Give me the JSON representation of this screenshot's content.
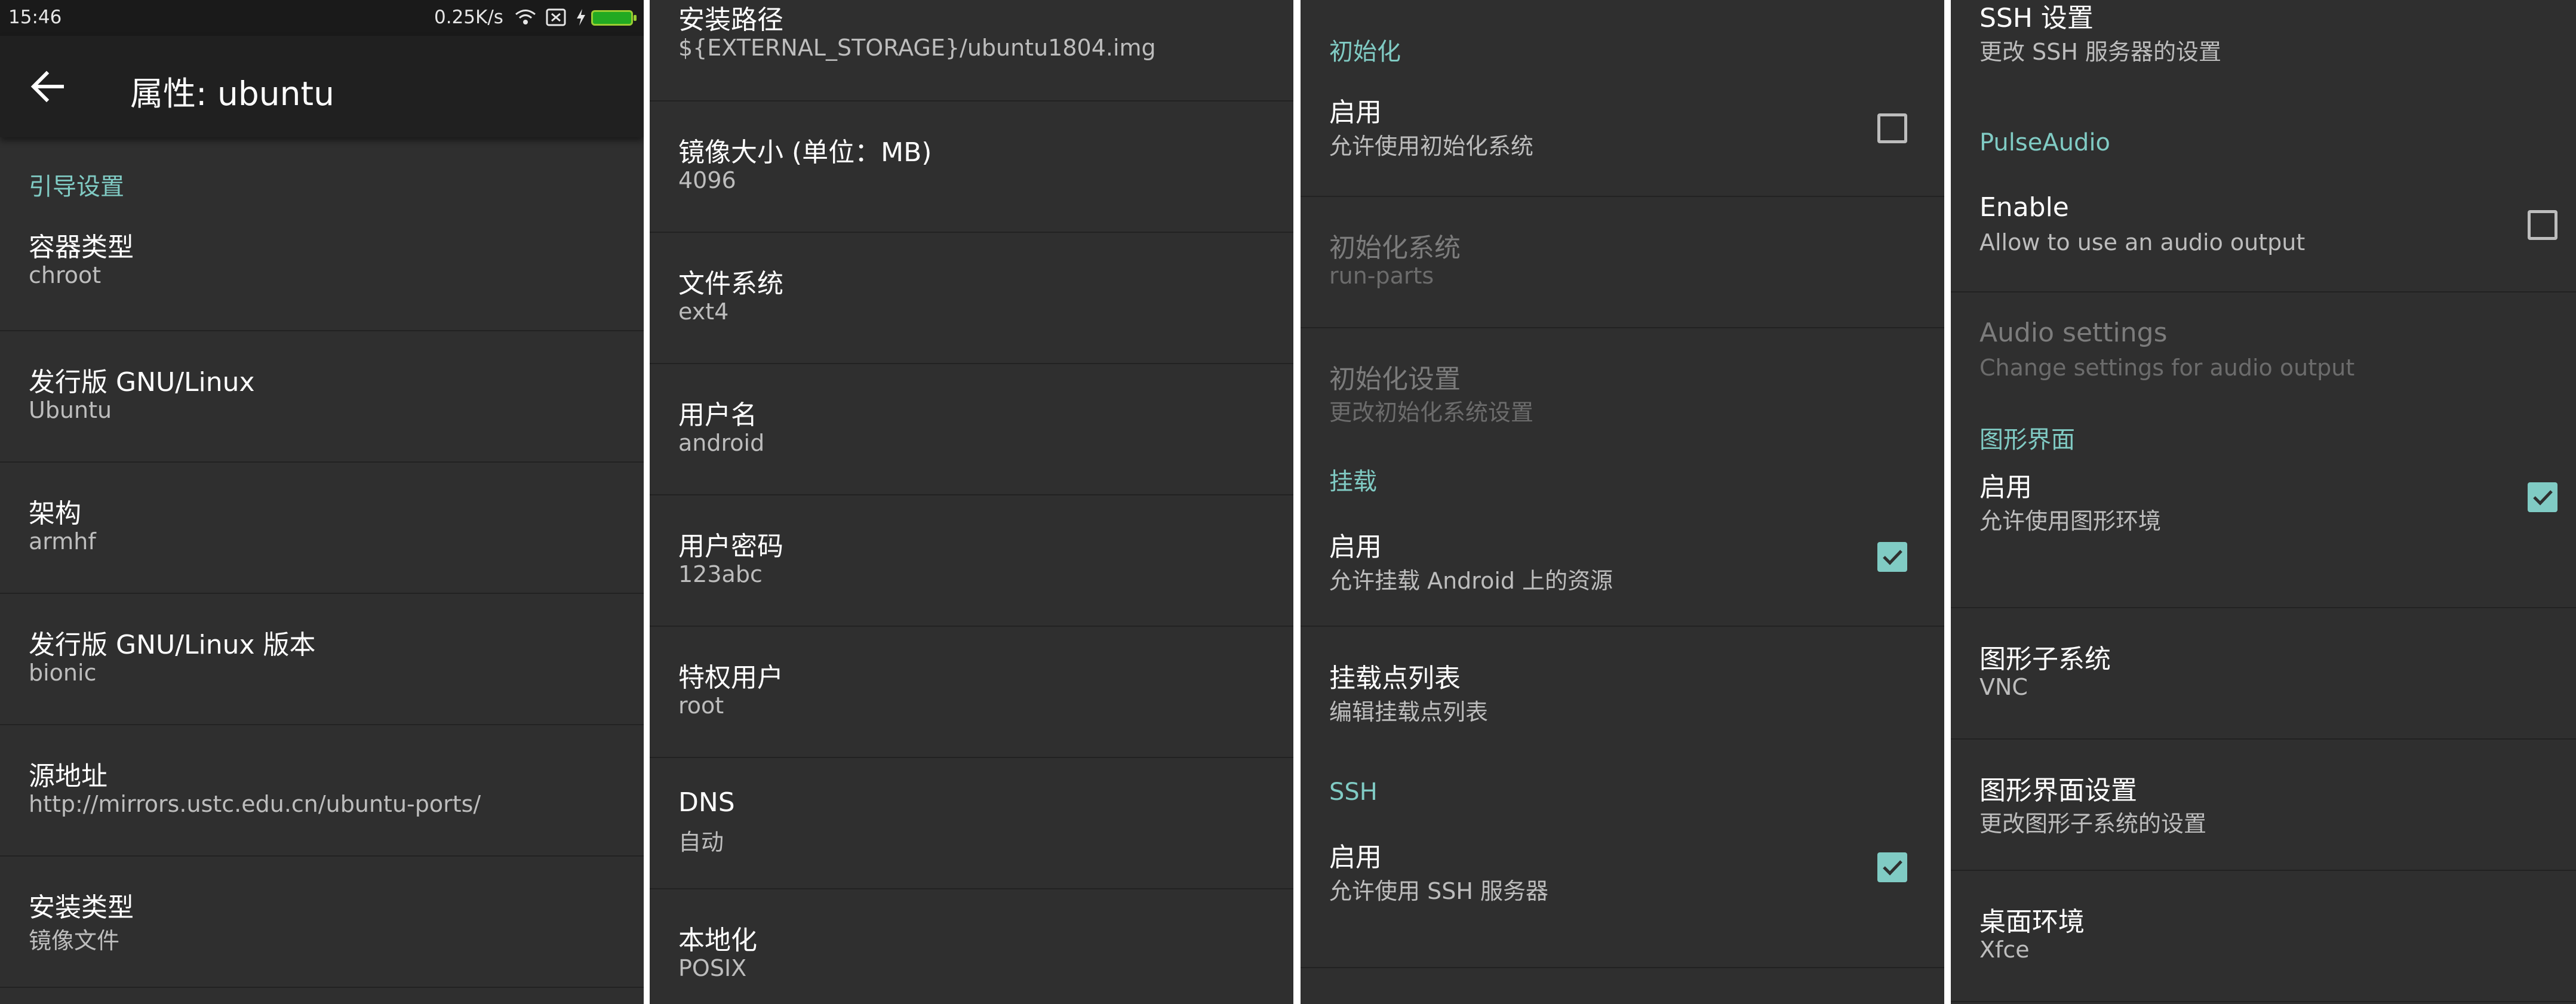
{
  "status_bar": {
    "time": "15:46",
    "speed": "0.25K/s"
  },
  "toolbar": {
    "title": "属性: ubuntu",
    "back_icon": "arrow-back-icon"
  },
  "colors": {
    "accent": "#80cbc4",
    "background": "#2f2f2f",
    "toolbar": "#202020",
    "statusbar": "#1a1a1a"
  },
  "panel1": {
    "category": "引导设置",
    "items": [
      {
        "title": "容器类型",
        "summary": "chroot"
      },
      {
        "title": "发行版 GNU/Linux",
        "summary": "Ubuntu"
      },
      {
        "title": "架构",
        "summary": "armhf"
      },
      {
        "title": "发行版 GNU/Linux 版本",
        "summary": "bionic"
      },
      {
        "title": "源地址",
        "summary": "http://mirrors.ustc.edu.cn/ubuntu-ports/"
      },
      {
        "title": "安装类型",
        "summary": "镜像文件"
      }
    ]
  },
  "panel2": {
    "items": [
      {
        "title": "安装路径",
        "summary": "${EXTERNAL_STORAGE}/ubuntu1804.img"
      },
      {
        "title": "镜像大小 (单位：MB)",
        "summary": "4096"
      },
      {
        "title": "文件系统",
        "summary": "ext4"
      },
      {
        "title": "用户名",
        "summary": "android"
      },
      {
        "title": "用户密码",
        "summary": "123abc"
      },
      {
        "title": "特权用户",
        "summary": "root"
      },
      {
        "title": "DNS",
        "summary": "自动"
      },
      {
        "title": "本地化",
        "summary": "POSIX"
      }
    ]
  },
  "panel3": {
    "init_category": "初始化",
    "init_enable": {
      "title": "启用",
      "summary": "允许使用初始化系统",
      "checked": false
    },
    "init_system": {
      "title": "初始化系统",
      "summary": "run-parts"
    },
    "init_settings": {
      "title": "初始化设置",
      "summary": "更改初始化系统设置"
    },
    "mount_category": "挂载",
    "mount_enable": {
      "title": "启用",
      "summary": "允许挂载 Android 上的资源",
      "checked": true
    },
    "mount_list": {
      "title": "挂载点列表",
      "summary": "编辑挂载点列表"
    },
    "ssh_category": "SSH",
    "ssh_enable": {
      "title": "启用",
      "summary": "允许使用 SSH 服务器",
      "checked": true
    }
  },
  "panel4": {
    "ssh_settings": {
      "title": "SSH 设置",
      "summary": "更改 SSH 服务器的设置"
    },
    "pulse_category": "PulseAudio",
    "pulse_enable": {
      "title": "Enable",
      "summary": "Allow to use an audio output",
      "checked": false
    },
    "audio_settings": {
      "title": "Audio settings",
      "summary": "Change settings for audio output"
    },
    "gui_category": "图形界面",
    "gui_enable": {
      "title": "启用",
      "summary": "允许使用图形环境",
      "checked": true
    },
    "gui_subsystem": {
      "title": "图形子系统",
      "summary": "VNC"
    },
    "gui_settings": {
      "title": "图形界面设置",
      "summary": "更改图形子系统的设置"
    },
    "desktop": {
      "title": "桌面环境",
      "summary": "Xfce"
    }
  }
}
